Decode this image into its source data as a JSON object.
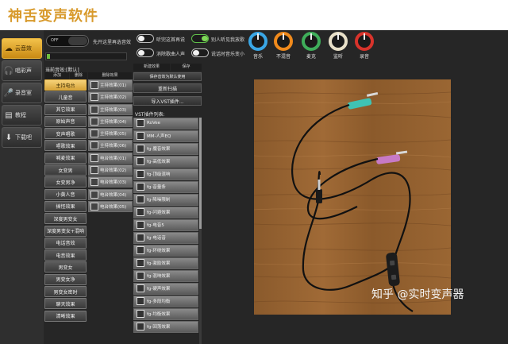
{
  "app": {
    "title": "神舌变声软件"
  },
  "nav": [
    {
      "label": "云音效",
      "icon": "cloud-icon",
      "active": true
    },
    {
      "label": "唱彩声",
      "icon": "headphones-icon",
      "active": false
    },
    {
      "label": "录音室",
      "icon": "microphone-icon",
      "active": false
    },
    {
      "label": "教程",
      "icon": "book-icon",
      "active": false
    },
    {
      "label": "下载吧",
      "icon": "download-icon",
      "active": false
    }
  ],
  "controls": {
    "main_toggle": {
      "state": "OFF",
      "label": "先开这里再选音效"
    },
    "switches": [
      {
        "label": "听完这首再说",
        "on": false
      },
      {
        "label": "别人听见我放歌",
        "on": true
      },
      {
        "label": "消除歌曲人声",
        "on": false
      },
      {
        "label": "说话时音乐变小",
        "on": false
      }
    ],
    "knobs": [
      {
        "label": "音乐",
        "color": "#3aa7e6"
      },
      {
        "label": "不混音",
        "color": "#f08a1c"
      },
      {
        "label": "麦克",
        "color": "#3fae5a"
      },
      {
        "label": "监听",
        "color": "#e8e0c8"
      },
      {
        "label": "录音",
        "color": "#d8332b"
      }
    ]
  },
  "preset": {
    "caption": "当前音效:[默认]"
  },
  "columns": {
    "add": "添加",
    "delete": "删除",
    "delete_effect": "删除效果",
    "new_effect": "新建效果",
    "save": "保存"
  },
  "voice_list": [
    {
      "label": "主持电台",
      "selected": true
    },
    {
      "label": "儿童音"
    },
    {
      "label": "其它效果"
    },
    {
      "label": "原始声音"
    },
    {
      "label": "变声唱歌"
    },
    {
      "label": "唱歌效果"
    },
    {
      "label": "喊麦效果"
    },
    {
      "label": "女变男"
    },
    {
      "label": "女变男净"
    },
    {
      "label": "小黄人音"
    },
    {
      "label": "搞怪效果"
    },
    {
      "label": "深度男变女"
    },
    {
      "label": "深度男变女+混响"
    },
    {
      "label": "电话音效"
    },
    {
      "label": "电音效果"
    },
    {
      "label": "男变女"
    },
    {
      "label": "男变女净"
    },
    {
      "label": "男变女密时"
    },
    {
      "label": "聊天效果"
    },
    {
      "label": "清晰效果"
    }
  ],
  "effect_list": [
    "主持效果(01)",
    "主持效果(02)",
    "主持效果(03)",
    "主持效果(04)",
    "主持效果(05)",
    "主持效果(06)",
    "电台效果(01)",
    "电台效果(02)",
    "电台效果(03)",
    "电台效果(04)",
    "电台效果(05)"
  ],
  "actions": {
    "save_as_default": "保存音效为默认使用",
    "reset": "重新扫描",
    "import_vst": "导入VST插件..."
  },
  "vst": {
    "title": "VST插件列表:",
    "plugins": [
      "RoVee",
      "MM-人声EQ",
      "fg-魔音效果",
      "fg-高低效果",
      "fg-顶级混响",
      "fg-音量条",
      "fg-降噪限制",
      "fg-闪避效果",
      "fg-电音5",
      "fg-电话音",
      "fg-环绕效果",
      "fg-激励效果",
      "fg-混响效果",
      "fg-硬声效果",
      "fg-多段均衡",
      "fg-均衡效果",
      "fg-回荡效果"
    ]
  },
  "watermark": "知乎 @实时变声器"
}
